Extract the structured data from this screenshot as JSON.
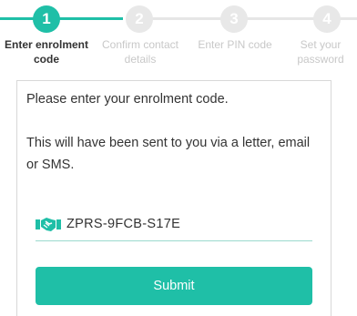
{
  "stepper": {
    "steps": [
      {
        "number": "1",
        "label": "Enter enrolment code",
        "active": true
      },
      {
        "number": "2",
        "label": "Confirm contact details",
        "active": false
      },
      {
        "number": "3",
        "label": "Enter PIN code",
        "active": false
      },
      {
        "number": "4",
        "label": "Set your password",
        "active": false
      }
    ]
  },
  "card": {
    "line1": "Please enter your enrolment code.",
    "line2": "This will have been sent to you via a letter, email or SMS.",
    "code_value": "ZPRS-9FCB-S17E",
    "code_icon": "handshake-icon",
    "submit_label": "Submit"
  },
  "colors": {
    "accent": "#1fbfa7",
    "inactive": "#e8e8e8",
    "text": "#333333"
  }
}
